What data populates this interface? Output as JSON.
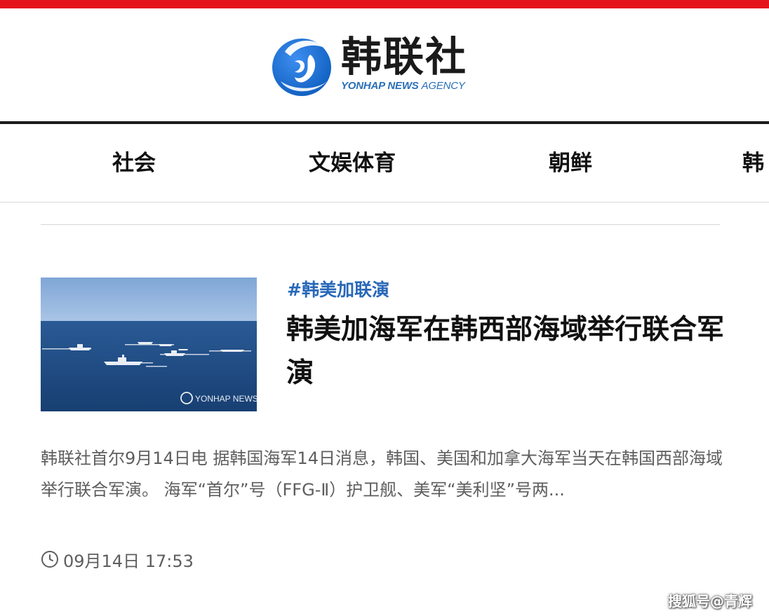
{
  "header": {
    "logo_cn": "韩联社",
    "logo_en_bold": "YONHAP NEWS ",
    "logo_en_light": "AGENCY",
    "logo_icon": "yonhap-globe-icon",
    "accent_color": "#e3151a",
    "brand_blue": "#1e6fd0"
  },
  "nav": {
    "items": [
      {
        "label": "社会"
      },
      {
        "label": "文娱体育"
      },
      {
        "label": "朝鲜"
      },
      {
        "label": "韩"
      }
    ]
  },
  "article": {
    "tag": "#韩美加联演",
    "title": "韩美加海军在韩西部海域举行联合军演",
    "summary": "韩联社首尔9月14日电 据韩国海军14日消息，韩国、美国和加拿大海军当天在韩国西部海域举行联合军演。 海军“首尔”号（FFG-Ⅱ）护卫舰、美军“美利坚”号两...",
    "time": "09月14日 17:53",
    "thumbnail_watermark": "YONHAP NEWS"
  },
  "footer": {
    "watermark": "搜狐号@青辉"
  }
}
